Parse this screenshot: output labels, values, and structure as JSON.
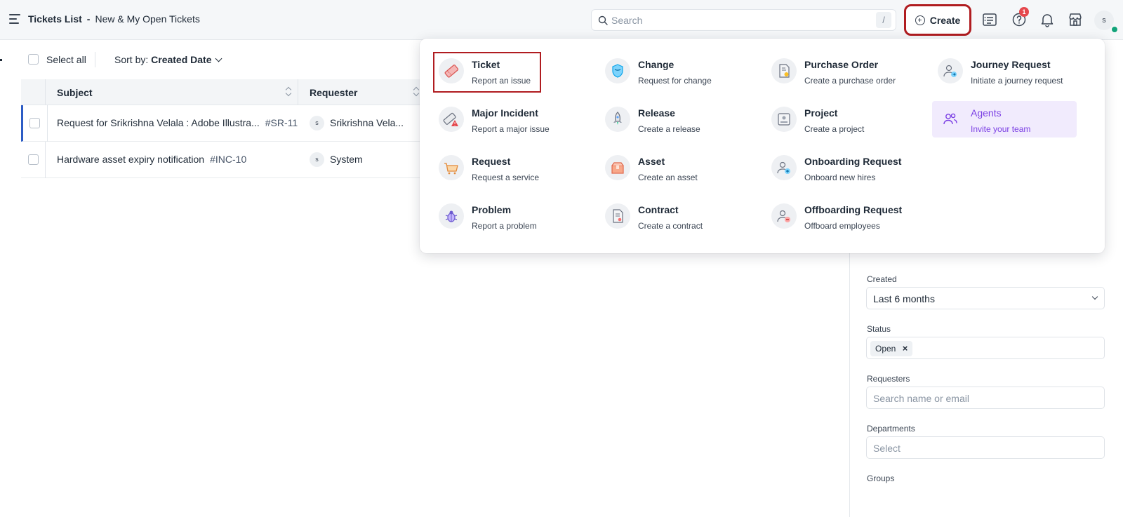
{
  "header": {
    "title": "Tickets List",
    "separator": "-",
    "view_name": "New & My Open Tickets",
    "search_placeholder": "Search",
    "search_shortcut": "/",
    "create_label": "Create",
    "help_badge_count": "1",
    "user_initial": "s"
  },
  "list": {
    "select_all_label": "Select all",
    "sort_prefix": "Sort by:",
    "sort_value": "Created Date",
    "columns": [
      "Subject",
      "Requester"
    ],
    "rows": [
      {
        "subject": "Request for Srikrishna Velala : Adobe Illustra...",
        "id": "#SR-11",
        "requester_initial": "s",
        "requester": "Srikrishna Vela..."
      },
      {
        "subject": "Hardware asset expiry notification",
        "id": "#INC-10",
        "requester_initial": "s",
        "requester": "System"
      }
    ]
  },
  "filters": {
    "created_label": "Created",
    "created_value": "Last 6 months",
    "status_label": "Status",
    "status_chip": "Open",
    "status_chip_remove": "×",
    "requesters_label": "Requesters",
    "requesters_placeholder": "Search name or email",
    "departments_label": "Departments",
    "departments_placeholder": "Select",
    "groups_label": "Groups"
  },
  "create_menu": {
    "items": [
      {
        "title": "Ticket",
        "subtitle": "Report an issue",
        "icon": "ticket-icon"
      },
      {
        "title": "Change",
        "subtitle": "Request for change",
        "icon": "shield-icon"
      },
      {
        "title": "Purchase Order",
        "subtitle": "Create a purchase order",
        "icon": "purchase-order-icon"
      },
      {
        "title": "Journey Request",
        "subtitle": "Initiate a journey request",
        "icon": "journey-icon"
      },
      {
        "title": "Major Incident",
        "subtitle": "Report a major issue",
        "icon": "major-incident-icon"
      },
      {
        "title": "Release",
        "subtitle": "Create a release",
        "icon": "rocket-icon"
      },
      {
        "title": "Project",
        "subtitle": "Create a project",
        "icon": "project-icon"
      },
      {
        "title": "Agents",
        "subtitle": "Invite your team",
        "icon": "agents-icon"
      },
      {
        "title": "Request",
        "subtitle": "Request a service",
        "icon": "cart-icon"
      },
      {
        "title": "Asset",
        "subtitle": "Create an asset",
        "icon": "box-icon"
      },
      {
        "title": "Onboarding Request",
        "subtitle": "Onboard new hires",
        "icon": "onboarding-icon"
      },
      {
        "title": "Problem",
        "subtitle": "Report a problem",
        "icon": "bug-icon"
      },
      {
        "title": "Contract",
        "subtitle": "Create a contract",
        "icon": "contract-icon"
      },
      {
        "title": "Offboarding Request",
        "subtitle": "Offboard employees",
        "icon": "offboarding-icon"
      }
    ]
  },
  "colors": {
    "accent_red": "#b01c20",
    "agents_purple": "#7b3fe4",
    "active_row_blue": "#2c5cc5",
    "status_online": "#12a37a"
  }
}
